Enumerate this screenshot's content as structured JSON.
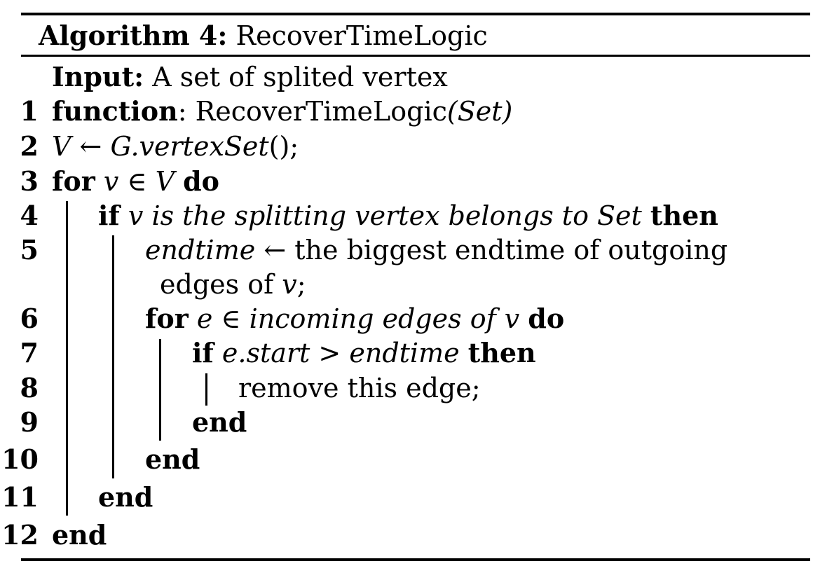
{
  "algorithm": {
    "label": "Algorithm 4:",
    "name": "RecoverTimeLogic"
  },
  "input": {
    "keyword": "Input:",
    "text": "A set of splited vertex"
  },
  "line_numbers": [
    "1",
    "2",
    "3",
    "4",
    "5",
    "6",
    "7",
    "8",
    "9",
    "10",
    "11",
    "12"
  ],
  "lines": {
    "l1": {
      "kw": "function",
      "colon": ":",
      "fn": "RecoverTimeLogic",
      "arg": "(Set)"
    },
    "l2": {
      "lhs": "V",
      "arrow": "←",
      "rhs": "G.vertexSet",
      "tail": "();"
    },
    "l3": {
      "kw_for": "for",
      "expr": "v ∈ V",
      "kw_do": "do"
    },
    "l4": {
      "kw_if": "if",
      "cond": "v is the splitting vertex belongs to Set",
      "kw_then": "then"
    },
    "l5": {
      "var": "endtime",
      "arrow": "←",
      "text1": "the biggest endtime of outgoing",
      "text2": "edges of",
      "var2": "v",
      "semi": ";"
    },
    "l6": {
      "kw_for": "for",
      "var": "e",
      "in": "∈",
      "expr": "incoming edges of v",
      "kw_do": "do"
    },
    "l7": {
      "kw_if": "if",
      "cond1": "e.start",
      "gt": ">",
      "cond2": "endtime",
      "kw_then": "then"
    },
    "l8": {
      "text": "remove this edge;"
    },
    "l9": {
      "kw": "end"
    },
    "l10": {
      "kw": "end"
    },
    "l11": {
      "kw": "end"
    },
    "l12": {
      "kw": "end"
    }
  }
}
